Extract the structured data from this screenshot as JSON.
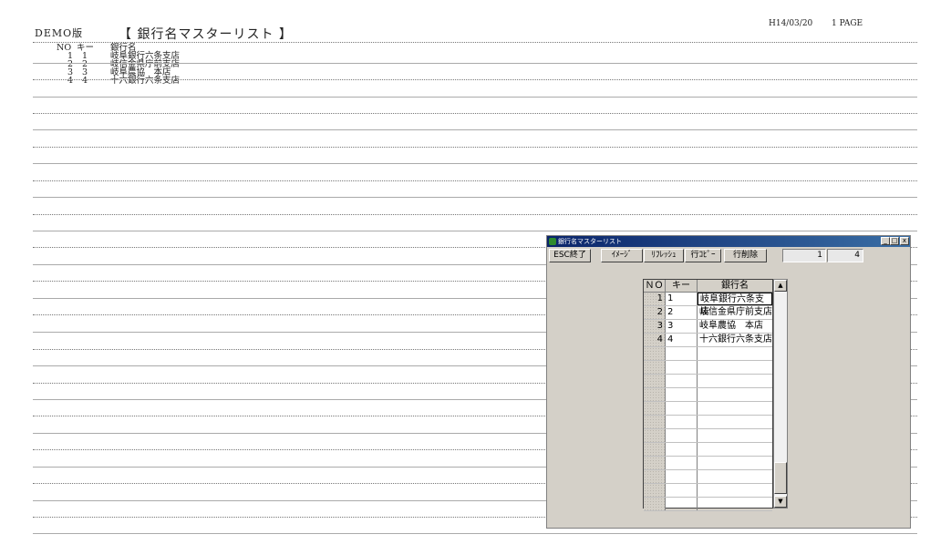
{
  "report": {
    "demo_label": "DEMO版",
    "title": "【 銀行名マスターリスト 】",
    "date": "H14/03/20",
    "page": "1 PAGE",
    "headers": {
      "no": "NO",
      "key": "キー",
      "name": "銀行名"
    },
    "rows": [
      {
        "no": "1",
        "key": "1",
        "name": "岐阜銀行六条支店"
      },
      {
        "no": "2",
        "key": "2",
        "name": "岐信金県庁前支店"
      },
      {
        "no": "3",
        "key": "3",
        "name": "岐阜農協　本店"
      },
      {
        "no": "4",
        "key": "4",
        "name": "十六銀行六条支店"
      }
    ]
  },
  "window": {
    "title": "銀行名マスターリスト",
    "buttons": {
      "minimize": "_",
      "maximize": "□",
      "close": "x"
    },
    "toolbar": {
      "esc": "ESC終了",
      "image": "ｲﾒｰｼﾞ",
      "refresh": "ﾘﾌﾚｯｼｭ",
      "copy_row": "行ｺﾋﾟｰ",
      "delete_row": "行削除"
    },
    "pager": {
      "current": "1",
      "total": "4"
    },
    "grid": {
      "headers": {
        "no": "ＮＯ",
        "key": "キー",
        "name": "銀行名"
      },
      "rows": [
        {
          "no": "1",
          "key": "1",
          "name": "岐阜銀行六条支店"
        },
        {
          "no": "2",
          "key": "2",
          "name": "岐信金県庁前支店"
        },
        {
          "no": "3",
          "key": "3",
          "name": "岐阜農協　本店"
        },
        {
          "no": "4",
          "key": "4",
          "name": "十六銀行六条支店"
        }
      ]
    },
    "scroll": {
      "up": "▲",
      "down": "▼"
    }
  }
}
